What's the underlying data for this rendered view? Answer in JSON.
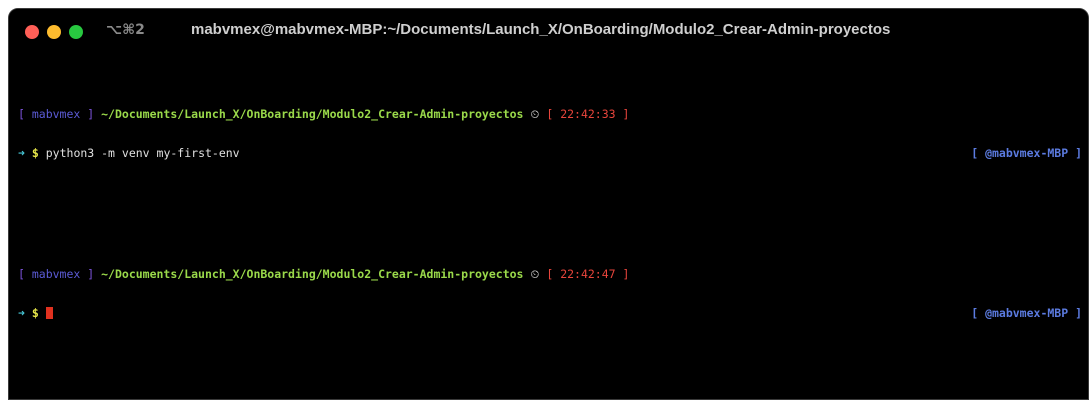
{
  "window": {
    "shortcut": "⌥⌘2",
    "title": "mabvmex@mabvmex-MBP:~/Documents/Launch_X/OnBoarding/Modulo2_Crear-Admin-proyectos"
  },
  "terminal": {
    "blocks": [
      {
        "user_open": "[ ",
        "user": "mabvmex",
        "user_close": " ]",
        "path": "~/Documents/Launch_X/OnBoarding/Modulo2_Crear-Admin-proyectos",
        "clock_icon": "⏲",
        "time_open": "[ ",
        "time": "22:42:33",
        "time_close": " ]",
        "arrow": "➜",
        "dollar": "$",
        "command": "python3 -m venv my-first-env",
        "rprompt": "[ @mabvmex-MBP ]"
      },
      {
        "user_open": "[ ",
        "user": "mabvmex",
        "user_close": " ]",
        "path": "~/Documents/Launch_X/OnBoarding/Modulo2_Crear-Admin-proyectos",
        "clock_icon": "⏲",
        "time_open": "[ ",
        "time": "22:42:47",
        "time_close": " ]",
        "arrow": "➜",
        "dollar": "$",
        "command": "",
        "rprompt": "[ @mabvmex-MBP ]"
      }
    ]
  },
  "colors": {
    "close": "#ff5f57",
    "minimize": "#febc2e",
    "maximize": "#28c840",
    "bracket": "#7b52d9",
    "user": "#5b5bd6",
    "path": "#9ad94a",
    "time": "#e8453c",
    "arrow": "#48c9d8",
    "dollar": "#e8e84a",
    "command": "#e0e0e0",
    "rprompt": "#5b7be0",
    "cursor": "#e0311f"
  }
}
